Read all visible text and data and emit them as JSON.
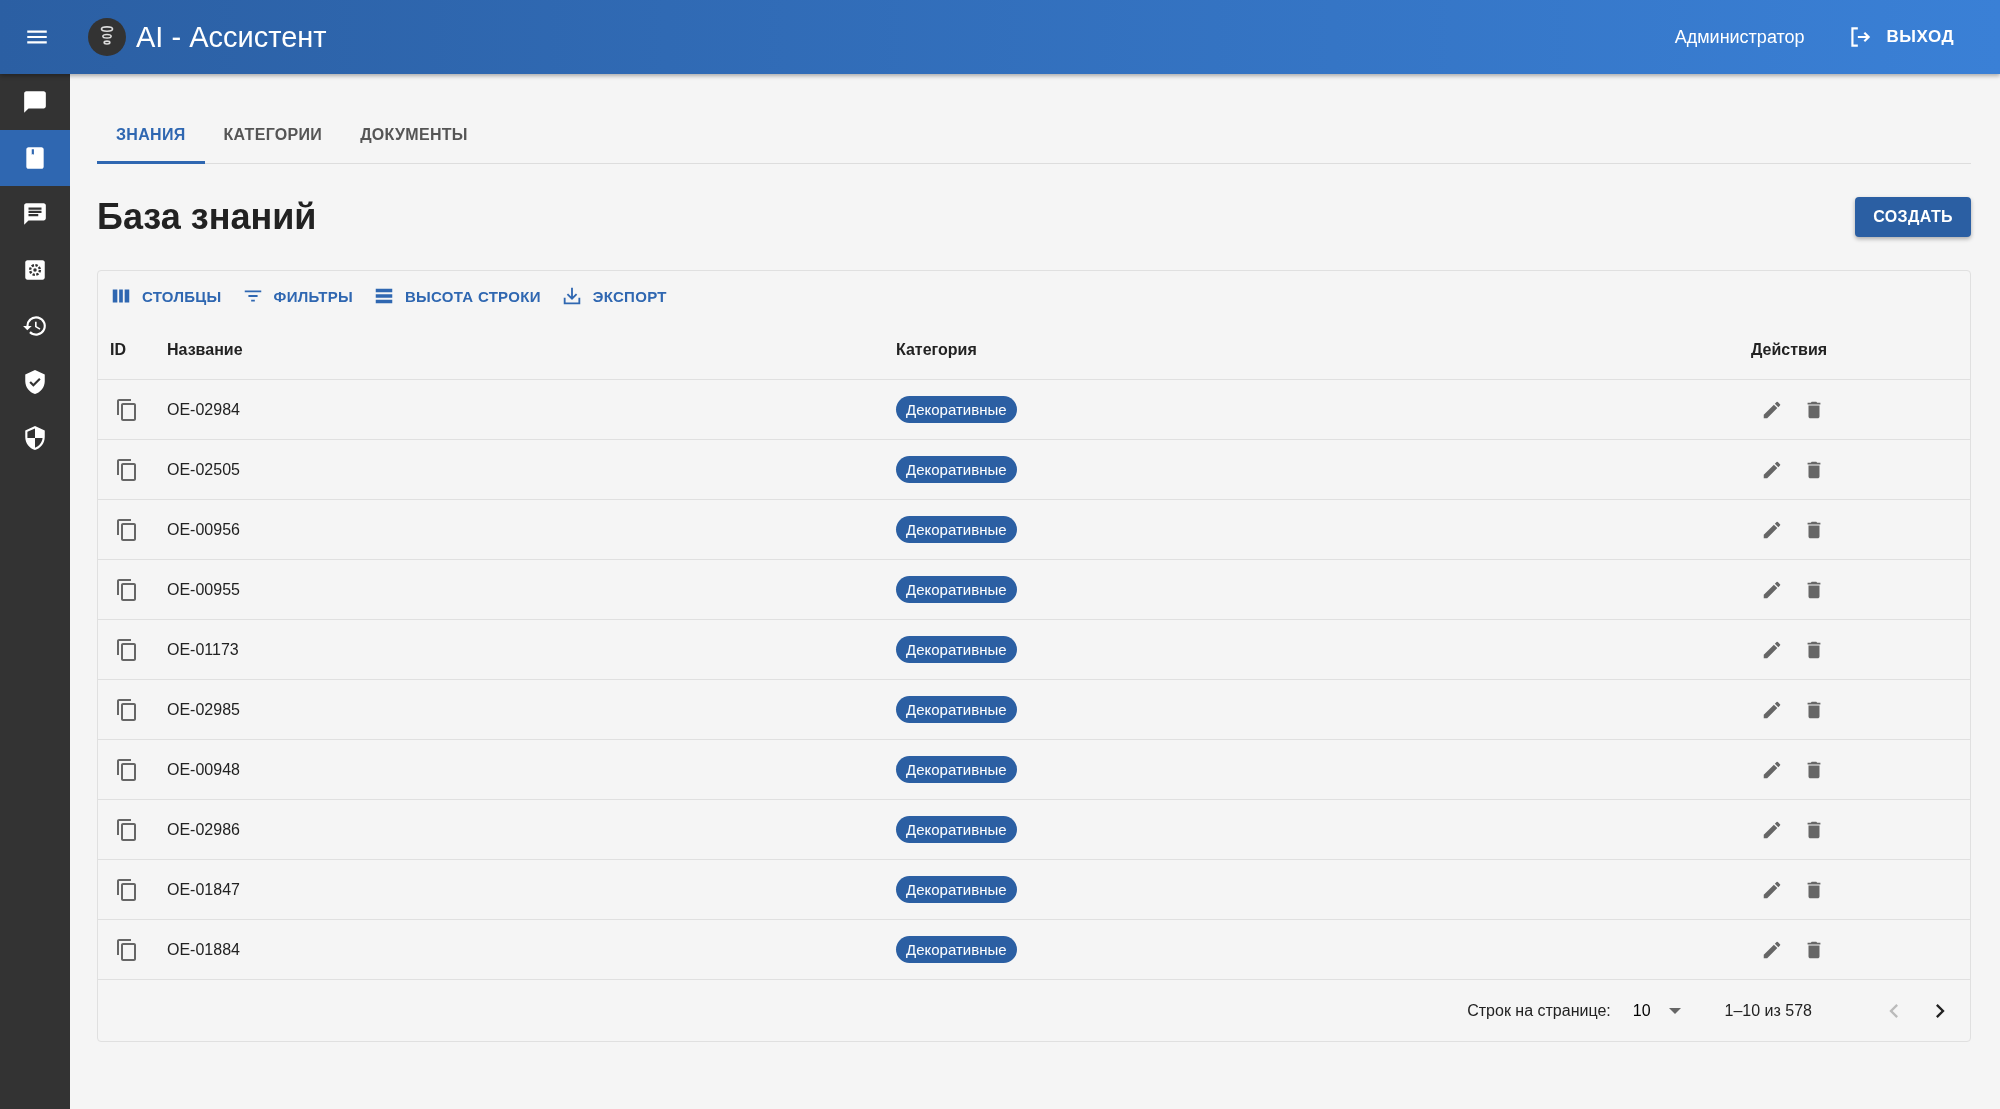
{
  "header": {
    "title": "AI - Ассистент",
    "user": "Администратор",
    "logout": "ВЫХОД"
  },
  "sidebar": {
    "items": [
      {
        "kind": "chat",
        "selected": false
      },
      {
        "kind": "book",
        "selected": true
      },
      {
        "kind": "message",
        "selected": false
      },
      {
        "kind": "settings",
        "selected": false
      },
      {
        "kind": "history",
        "selected": false
      },
      {
        "kind": "shield-check",
        "selected": false
      },
      {
        "kind": "shield",
        "selected": false
      }
    ]
  },
  "tabs": [
    {
      "label": "ЗНАНИЯ",
      "selected": true
    },
    {
      "label": "КАТЕГОРИИ",
      "selected": false
    },
    {
      "label": "ДОКУМЕНТЫ",
      "selected": false
    }
  ],
  "page_title": "База знаний",
  "create_button": "СОЗДАТЬ",
  "toolbar": [
    {
      "kind": "columns",
      "label": "СТОЛБЦЫ"
    },
    {
      "kind": "filters",
      "label": "ФИЛЬТРЫ"
    },
    {
      "kind": "density",
      "label": "ВЫСОТА СТРОКИ"
    },
    {
      "kind": "export",
      "label": "ЭКСПОРТ"
    }
  ],
  "table": {
    "columns": [
      "ID",
      "Название",
      "Категория",
      "Действия"
    ],
    "rows": [
      {
        "name": "OE-02984",
        "category": "Декоративные"
      },
      {
        "name": "OE-02505",
        "category": "Декоративные"
      },
      {
        "name": "OE-00956",
        "category": "Декоративные"
      },
      {
        "name": "OE-00955",
        "category": "Декоративные"
      },
      {
        "name": "OE-01173",
        "category": "Декоративные"
      },
      {
        "name": "OE-02985",
        "category": "Декоративные"
      },
      {
        "name": "OE-00948",
        "category": "Декоративные"
      },
      {
        "name": "OE-02986",
        "category": "Декоративные"
      },
      {
        "name": "OE-01847",
        "category": "Декоративные"
      },
      {
        "name": "OE-01884",
        "category": "Декоративные"
      }
    ]
  },
  "pagination": {
    "rows_label": "Строк на странице:",
    "rows_per_page": "10",
    "range": "1–10 из 578",
    "prev_disabled": true,
    "next_disabled": false
  }
}
